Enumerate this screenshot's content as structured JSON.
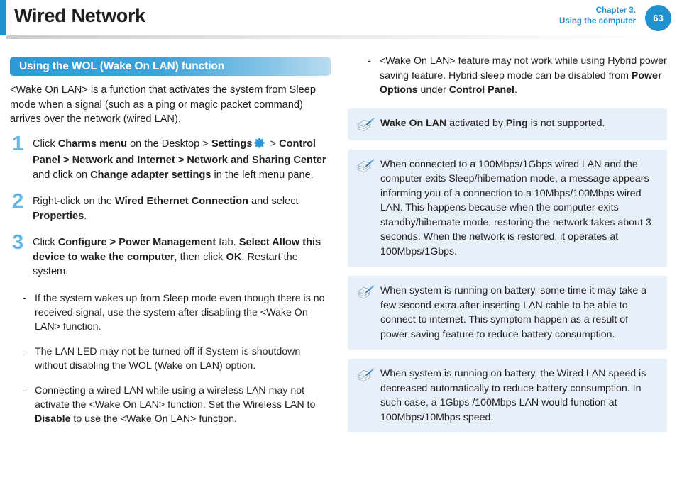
{
  "header": {
    "title": "Wired Network",
    "chapter_line1": "Chapter 3.",
    "chapter_line2": "Using the computer",
    "page_number": "63",
    "accent_color": "#2092d0"
  },
  "left_column": {
    "section_heading": "Using the WOL (Wake On LAN) function",
    "intro_paragraph": "<Wake On LAN> is a function that activates the system from Sleep mode when a signal (such as a ping or magic packet command) arrives over the network (wired LAN).",
    "steps": [
      {
        "number": "1",
        "segments": [
          {
            "text": "Click ",
            "bold": false
          },
          {
            "text": "Charms menu",
            "bold": true
          },
          {
            "text": " on the Desktop > ",
            "bold": false
          },
          {
            "text": "Settings",
            "bold": true
          },
          {
            "icon": "gear-icon"
          },
          {
            "text": " > ",
            "bold": false
          },
          {
            "text": "Control Panel > Network and Internet > Network and Sharing Center",
            "bold": true
          },
          {
            "text": " and click on ",
            "bold": false
          },
          {
            "text": "Change adapter settings",
            "bold": true
          },
          {
            "text": " in the left menu pane.",
            "bold": false
          }
        ]
      },
      {
        "number": "2",
        "segments": [
          {
            "text": "Right-click on the ",
            "bold": false
          },
          {
            "text": "Wired Ethernet Connection",
            "bold": true
          },
          {
            "text": " and select ",
            "bold": false
          },
          {
            "text": "Properties",
            "bold": true
          },
          {
            "text": ".",
            "bold": false
          }
        ]
      },
      {
        "number": "3",
        "segments": [
          {
            "text": "Click ",
            "bold": false
          },
          {
            "text": "Configure > Power Management",
            "bold": true
          },
          {
            "text": " tab. ",
            "bold": false
          },
          {
            "text": "Select Allow this device to wake the computer",
            "bold": true
          },
          {
            "text": ", then click ",
            "bold": false
          },
          {
            "text": "OK",
            "bold": true
          },
          {
            "text": ". Restart the system.",
            "bold": false
          }
        ]
      }
    ],
    "bullets": [
      {
        "dash": "-",
        "segments": [
          {
            "text": "If the system wakes up from Sleep mode even though there is no received signal, use the system after disabling the <Wake On LAN> function.",
            "bold": false
          }
        ]
      },
      {
        "dash": "-",
        "segments": [
          {
            "text": "The LAN LED may not be turned off if System is shoutdown without disabling the WOL (Wake on LAN) option.",
            "bold": false
          }
        ]
      },
      {
        "dash": "-",
        "segments": [
          {
            "text": "Connecting a wired LAN while using a wireless LAN may not activate the <Wake On LAN> function. Set the Wireless LAN to ",
            "bold": false
          },
          {
            "text": "Disable",
            "bold": true
          },
          {
            "text": " to use the <Wake On LAN> function.",
            "bold": false
          }
        ]
      }
    ]
  },
  "right_column": {
    "bullets": [
      {
        "dash": "-",
        "segments": [
          {
            "text": "<Wake On LAN> feature may not work while using Hybrid power saving feature. Hybrid sleep mode can be disabled from ",
            "bold": false
          },
          {
            "text": "Power Options",
            "bold": true
          },
          {
            "text": " under ",
            "bold": false
          },
          {
            "text": "Control Panel",
            "bold": true
          },
          {
            "text": ".",
            "bold": false
          }
        ]
      }
    ],
    "notes": [
      {
        "icon": "note-pencil-icon",
        "segments": [
          {
            "text": "Wake On LAN",
            "bold": true
          },
          {
            "text": " activated by ",
            "bold": false
          },
          {
            "text": "Ping",
            "bold": true
          },
          {
            "text": " is not supported.",
            "bold": false
          }
        ]
      },
      {
        "icon": "note-pencil-icon",
        "segments": [
          {
            "text": "When connected to a 100Mbps/1Gbps wired LAN and the computer exits Sleep/hibernation mode, a message appears informing you of a connection to a 10Mbps/100Mbps wired LAN. This happens because when the computer exits standby/hibernate mode, restoring the network takes about 3 seconds. When the network is restored, it operates at 100Mbps/1Gbps.",
            "bold": false
          }
        ]
      },
      {
        "icon": "note-pencil-icon",
        "segments": [
          {
            "text": "When system is running on battery, some time it may take a few second extra after inserting LAN cable to be able to connect to internet. This symptom happen as a result of power saving feature to reduce battery consumption.",
            "bold": false
          }
        ]
      },
      {
        "icon": "note-pencil-icon",
        "segments": [
          {
            "text": "When system is running on battery, the Wired LAN speed is decreased automatically to reduce battery consumption. In such case, a 1Gbps /100Mbps LAN would function at 100Mbps/10Mbps speed.",
            "bold": false
          }
        ]
      }
    ]
  },
  "colors": {
    "accent_blue": "#2092d0",
    "step_number_blue": "#63b6e3",
    "note_background": "#e7f0f8",
    "text": "#231f20"
  }
}
